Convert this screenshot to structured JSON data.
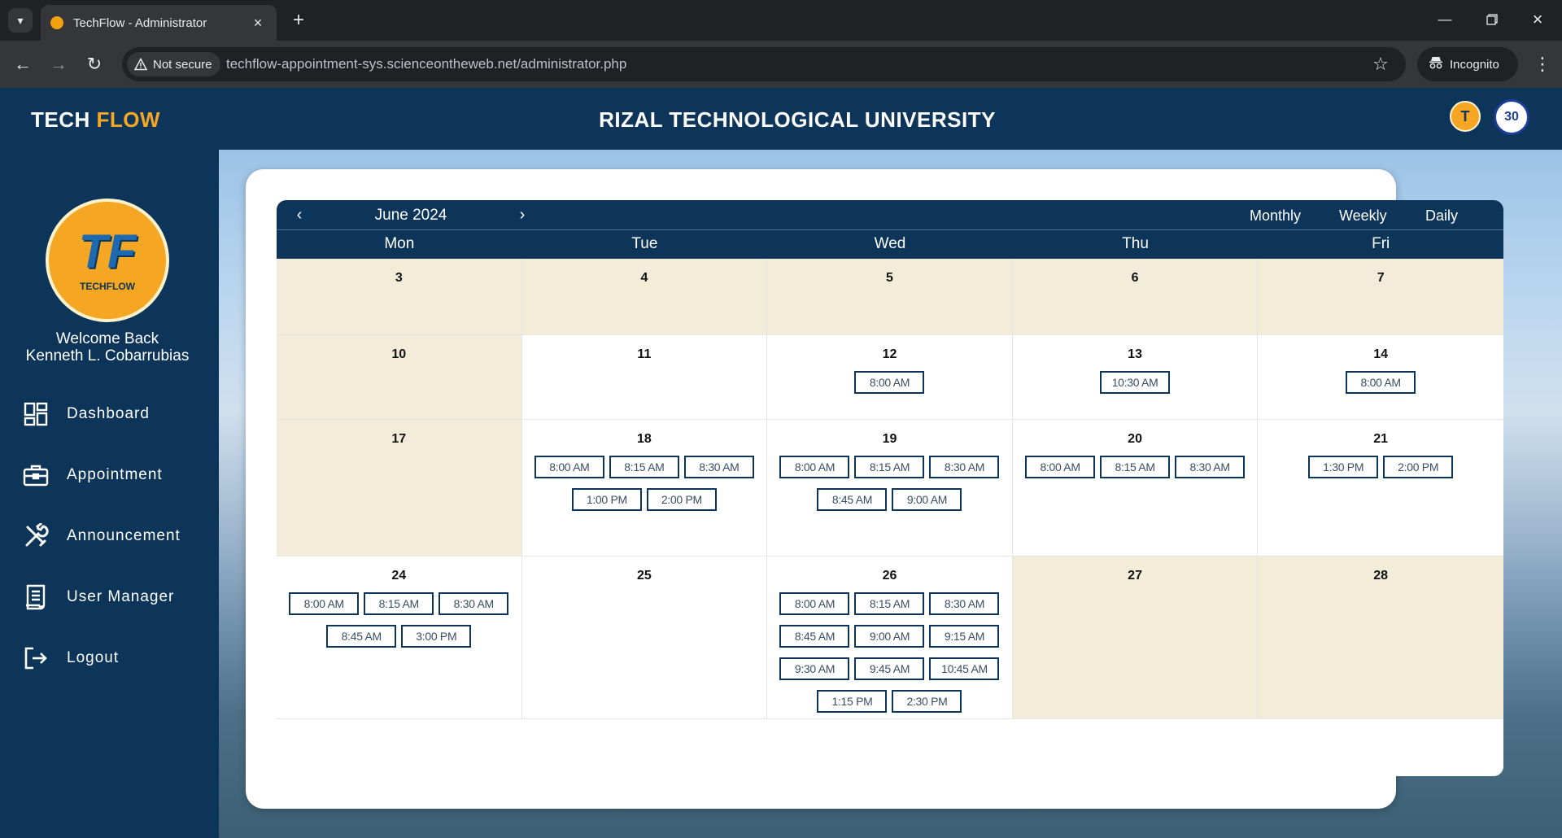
{
  "browser": {
    "tab_title": "TechFlow - Administrator",
    "security_label": "Not secure",
    "url": "techflow-appointment-sys.scienceontheweb.net/administrator.php",
    "incognito_label": "Incognito"
  },
  "header": {
    "brand_part1": "TECH",
    "brand_part2": "FLOW",
    "university": "RIZAL TECHNOLOGICAL UNIVERSITY",
    "seal_text": "30"
  },
  "sidebar": {
    "logo_text": "TECHFLOW",
    "welcome_line1": "Welcome Back",
    "welcome_line2": "Kenneth L. Cobarrubias",
    "items": [
      {
        "label": "Dashboard",
        "icon": "dashboard-icon"
      },
      {
        "label": "Appointment",
        "icon": "briefcase-icon"
      },
      {
        "label": "Announcement",
        "icon": "tools-icon"
      },
      {
        "label": "User Manager",
        "icon": "document-icon"
      },
      {
        "label": "Logout",
        "icon": "logout-icon"
      }
    ]
  },
  "calendar": {
    "month_label": "June 2024",
    "prev_symbol": "‹",
    "next_symbol": "›",
    "views": [
      "Monthly",
      "Weekly",
      "Daily"
    ],
    "weekdays": [
      "Mon",
      "Tue",
      "Wed",
      "Thu",
      "Fri"
    ],
    "weeks": [
      {
        "days": [
          {
            "day": "3",
            "off": true,
            "slots": []
          },
          {
            "day": "4",
            "off": true,
            "slots": []
          },
          {
            "day": "5",
            "off": true,
            "slots": []
          },
          {
            "day": "6",
            "off": true,
            "slots": []
          },
          {
            "day": "7",
            "off": true,
            "slots": []
          }
        ]
      },
      {
        "days": [
          {
            "day": "10",
            "off": true,
            "slots": []
          },
          {
            "day": "11",
            "off": false,
            "slots": []
          },
          {
            "day": "12",
            "off": false,
            "slots": [
              "8:00 AM"
            ]
          },
          {
            "day": "13",
            "off": false,
            "slots": [
              "10:30 AM"
            ]
          },
          {
            "day": "14",
            "off": false,
            "slots": [
              "8:00 AM"
            ]
          }
        ]
      },
      {
        "days": [
          {
            "day": "17",
            "off": true,
            "slots": []
          },
          {
            "day": "18",
            "off": false,
            "slots": [
              "8:00 AM",
              "8:15 AM",
              "8:30 AM",
              "1:00 PM",
              "2:00 PM"
            ]
          },
          {
            "day": "19",
            "off": false,
            "slots": [
              "8:00 AM",
              "8:15 AM",
              "8:30 AM",
              "8:45 AM",
              "9:00 AM"
            ]
          },
          {
            "day": "20",
            "off": false,
            "slots": [
              "8:00 AM",
              "8:15 AM",
              "8:30 AM"
            ]
          },
          {
            "day": "21",
            "off": false,
            "slots": [
              "1:30 PM",
              "2:00 PM"
            ]
          }
        ]
      },
      {
        "days": [
          {
            "day": "24",
            "off": false,
            "slots": [
              "8:00 AM",
              "8:15 AM",
              "8:30 AM",
              "8:45 AM",
              "3:00 PM"
            ]
          },
          {
            "day": "25",
            "off": false,
            "slots": []
          },
          {
            "day": "26",
            "off": false,
            "slots": [
              "8:00 AM",
              "8:15 AM",
              "8:30 AM",
              "8:45 AM",
              "9:00 AM",
              "9:15 AM",
              "9:30 AM",
              "9:45 AM",
              "10:45 AM",
              "1:15 PM",
              "2:30 PM"
            ]
          },
          {
            "day": "27",
            "off": true,
            "slots": []
          },
          {
            "day": "28",
            "off": true,
            "slots": []
          }
        ]
      }
    ]
  },
  "colors": {
    "navy": "#0d3559",
    "accent": "#f5a623",
    "off_day": "#f2ecd8"
  }
}
